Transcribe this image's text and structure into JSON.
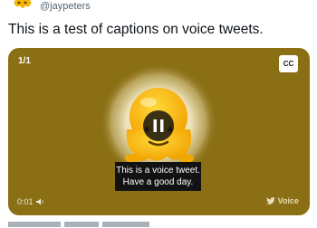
{
  "tweet": {
    "handle": "@jaypeters",
    "text": "This is a test of captions on voice tweets."
  },
  "player": {
    "counter": "1/1",
    "cc_label": "CC",
    "caption_lines": [
      "This is a voice tweet.",
      "Have a good day."
    ],
    "elapsed": "0:01",
    "voice_label": "Voice",
    "background_color": "#8b6f14",
    "state": "playing"
  },
  "icons": {
    "avatar": "melting-face-emoji",
    "center": "melting-face-emoji",
    "control": "pause-icon",
    "volume": "speaker-icon",
    "badge": "twitter-bird-icon"
  }
}
